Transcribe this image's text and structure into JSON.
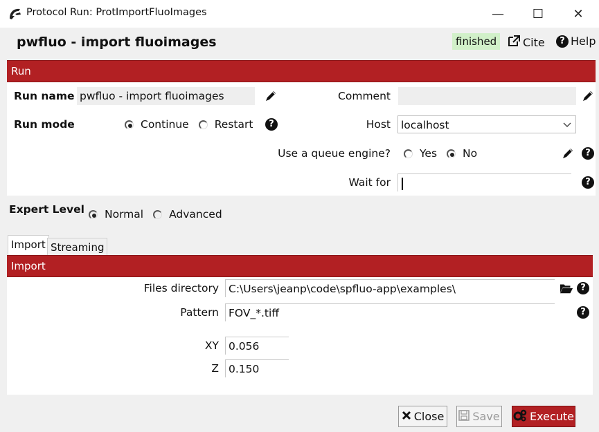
{
  "window": {
    "title": "Protocol Run: ProtImportFluoImages",
    "minimize_label": "—",
    "maximize_label": "☐",
    "close_label": "✕"
  },
  "header": {
    "title": "pwfluo - import fluoimages",
    "status": "finished",
    "cite_label": "Cite",
    "help_label": "Help"
  },
  "run_section": {
    "header": "Run",
    "run_name_label": "Run name",
    "run_name_value": "pwfluo - import fluoimages",
    "comment_label": "Comment",
    "comment_value": "",
    "run_mode_label": "Run mode",
    "run_mode_options": [
      "Continue",
      "Restart"
    ],
    "run_mode_selected": "Continue",
    "host_label": "Host",
    "host_value": "localhost",
    "queue_label": "Use a queue engine?",
    "queue_options": [
      "Yes",
      "No"
    ],
    "queue_selected": "No",
    "wait_for_label": "Wait for",
    "wait_for_value": ""
  },
  "expert_level": {
    "label": "Expert Level",
    "options": [
      "Normal",
      "Advanced"
    ],
    "selected": "Normal"
  },
  "tabs": [
    {
      "label": "Import",
      "active": true
    },
    {
      "label": "Streaming",
      "active": false
    }
  ],
  "import_section": {
    "header": "Import",
    "files_directory_label": "Files directory",
    "files_directory_value": "C:\\Users\\jeanp\\code\\spfluo-app\\examples\\",
    "pattern_label": "Pattern",
    "pattern_value": "FOV_*.tiff",
    "xy_label": "XY",
    "xy_value": "0.056",
    "z_label": "Z",
    "z_value": "0.150"
  },
  "buttons": {
    "close_label": "Close",
    "save_label": "Save",
    "execute_label": "Execute"
  },
  "colors": {
    "section_header": "#b22023",
    "status_bg": "#d1f0c9",
    "execute_bg": "#b22023",
    "window_bg": "#f0f0f0"
  },
  "icons": [
    "app-icon",
    "pencil-icon",
    "help-icon",
    "folder-open-icon",
    "external-link-icon",
    "close-x-icon",
    "save-icon",
    "gears-icon",
    "chevron-down-icon"
  ]
}
